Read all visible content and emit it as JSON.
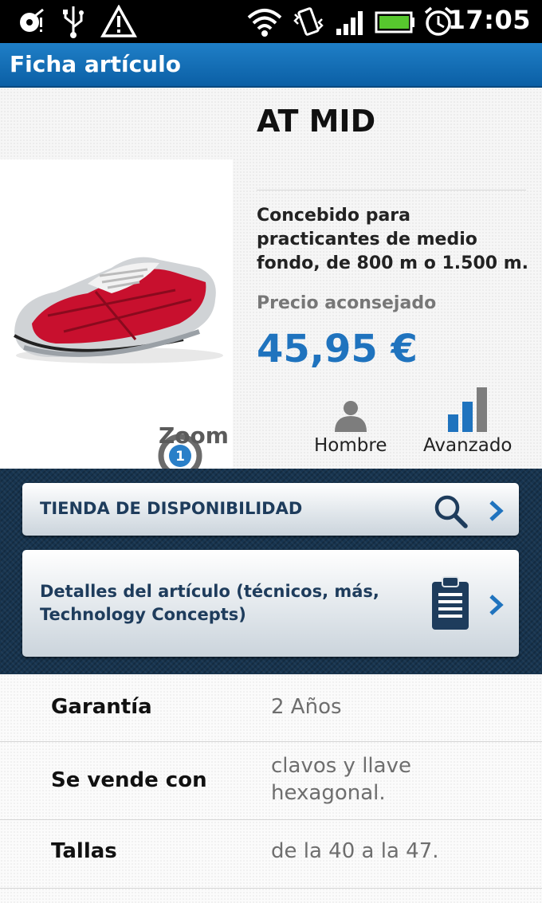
{
  "status_bar": {
    "time": "17:05",
    "icons": [
      "debug-icon",
      "usb-icon",
      "warning-icon",
      "wifi-icon",
      "vibrate-icon",
      "signal-icon",
      "battery-icon",
      "alarm-icon"
    ]
  },
  "header": {
    "title": "Ficha artículo"
  },
  "product": {
    "name": "AT MID",
    "description": "Concebido para practicantes de medio fondo, de 800 m o 1.500 m.",
    "price_label": "Precio aconsejado",
    "price": "45,95 €",
    "zoom_label": "Zoom",
    "zoom_badge": "1",
    "gender": "Hombre",
    "level": "Avanzado"
  },
  "actions": {
    "availability_label": "TIENDA DE DISPONIBILIDAD",
    "details_label": "Detalles del artículo (técnicos, más, Technology Concepts)"
  },
  "specs": [
    {
      "label": "Garantía",
      "value": "2 Años"
    },
    {
      "label": "Se vende con",
      "value": "clavos y llave hexagonal."
    },
    {
      "label": "Tallas",
      "value": "de la 40 a la 47."
    }
  ],
  "colors": {
    "header_blue": "#1a70b8",
    "price_blue": "#1f73be",
    "dark_panel": "#17344f",
    "button_text": "#1e3c5c"
  }
}
